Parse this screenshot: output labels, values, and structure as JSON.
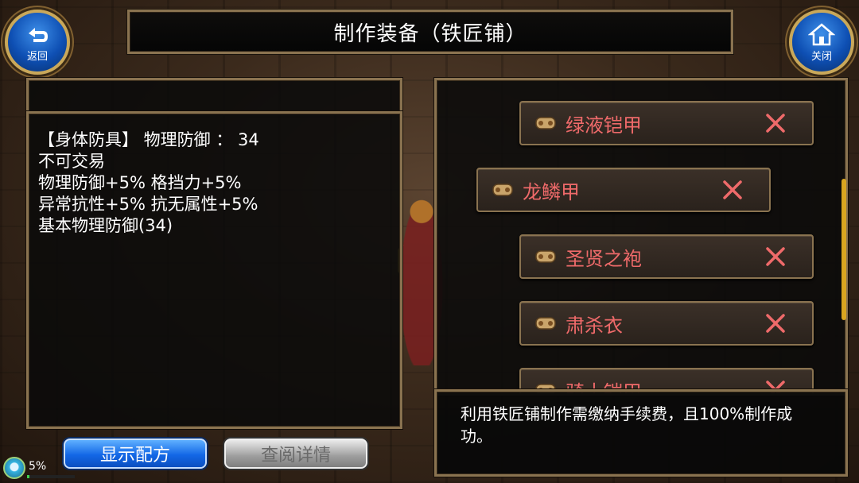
{
  "header": {
    "title": "制作装备（铁匠铺）",
    "back_label": "返回",
    "close_label": "关闭"
  },
  "item_info": {
    "lines": [
      "【身体防具】 物理防御 ： 34",
      "不可交易",
      "物理防御+5% 格挡力+5%",
      "异常抗性+5% 抗无属性+5%",
      "基本物理防御(34)"
    ]
  },
  "recipes": [
    {
      "name": "绿液铠甲",
      "selected": false
    },
    {
      "name": "龙鳞甲",
      "selected": true
    },
    {
      "name": "圣贤之袍",
      "selected": false
    },
    {
      "name": "肃杀衣",
      "selected": false
    },
    {
      "name": "骑士铠甲",
      "selected": false
    }
  ],
  "message": "利用铁匠铺制作需缴纳手续费，且100%制作成功。",
  "buttons": {
    "show_recipe": "显示配方",
    "view_details": "查阅详情"
  },
  "status": {
    "percent_label": "5%",
    "percent_value": 5
  },
  "colors": {
    "recipe_name": "#ef6a6a",
    "frame_gold": "#8a7350",
    "button_blue": "#1367e6",
    "scrollbar": "#d9a520"
  }
}
